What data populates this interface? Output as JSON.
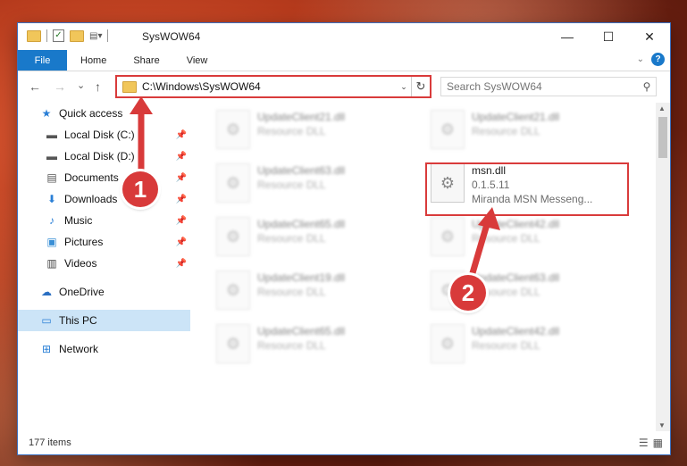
{
  "window": {
    "title": "SysWOW64"
  },
  "titlebar": {
    "minimize": "—",
    "maximize": "☐",
    "close": "✕"
  },
  "ribbon": {
    "tabs": [
      "File",
      "Home",
      "Share",
      "View"
    ],
    "help": "?"
  },
  "nav": {
    "back": "←",
    "forward": "→",
    "recent": "⌄",
    "up": "↑"
  },
  "address": {
    "path": "C:\\Windows\\SysWOW64"
  },
  "search": {
    "placeholder": "Search SysWOW64"
  },
  "sidebar": {
    "items": [
      {
        "label": "Quick access",
        "icon": "star-icon",
        "glyph": "★",
        "color": "#2a7fd6",
        "pinned": false
      },
      {
        "label": "Local Disk (C:)",
        "icon": "drive-icon",
        "glyph": "▬",
        "color": "#555",
        "pinned": true
      },
      {
        "label": "Local Disk (D:)",
        "icon": "drive-icon",
        "glyph": "▬",
        "color": "#555",
        "pinned": true
      },
      {
        "label": "Documents",
        "icon": "document-icon",
        "glyph": "▤",
        "color": "#555",
        "pinned": true
      },
      {
        "label": "Downloads",
        "icon": "download-icon",
        "glyph": "⬇",
        "color": "#2a7fd6",
        "pinned": true
      },
      {
        "label": "Music",
        "icon": "music-icon",
        "glyph": "♪",
        "color": "#2a7fd6",
        "pinned": true
      },
      {
        "label": "Pictures",
        "icon": "pictures-icon",
        "glyph": "▣",
        "color": "#3a8fd6",
        "pinned": true
      },
      {
        "label": "Videos",
        "icon": "videos-icon",
        "glyph": "▥",
        "color": "#444",
        "pinned": true
      },
      {
        "label": "OneDrive",
        "icon": "cloud-icon",
        "glyph": "☁",
        "color": "#2a6fc2",
        "pinned": false
      },
      {
        "label": "This PC",
        "icon": "computer-icon",
        "glyph": "▭",
        "color": "#2a7fd6",
        "pinned": false
      },
      {
        "label": "Network",
        "icon": "network-icon",
        "glyph": "⊞",
        "color": "#2a7fd6",
        "pinned": false
      }
    ]
  },
  "files": [
    {
      "name": "UpdateClient21.dll",
      "sub1": "Resource DLL",
      "sub2": ""
    },
    {
      "name": "UpdateClient21.dll",
      "sub1": "Resource DLL",
      "sub2": ""
    },
    {
      "name": "UpdateClient63.dll",
      "sub1": "Resource DLL",
      "sub2": ""
    },
    {
      "name": "msn.dll",
      "sub1": "0.1.5.11",
      "sub2": "Miranda MSN Messeng..."
    },
    {
      "name": "UpdateClient65.dll",
      "sub1": "Resource DLL",
      "sub2": ""
    },
    {
      "name": "UpdateClient42.dll",
      "sub1": "Resource DLL",
      "sub2": ""
    },
    {
      "name": "UpdateClient19.dll",
      "sub1": "Resource DLL",
      "sub2": ""
    },
    {
      "name": "UpdateClient63.dll",
      "sub1": "Resource DLL",
      "sub2": ""
    },
    {
      "name": "UpdateClient65.dll",
      "sub1": "Resource DLL",
      "sub2": ""
    },
    {
      "name": "UpdateClient42.dll",
      "sub1": "Resource DLL",
      "sub2": ""
    }
  ],
  "status": {
    "count": "177 items"
  },
  "callouts": [
    "1",
    "2"
  ],
  "colors": {
    "accent": "#1979ca",
    "highlight": "#d93b3b"
  }
}
